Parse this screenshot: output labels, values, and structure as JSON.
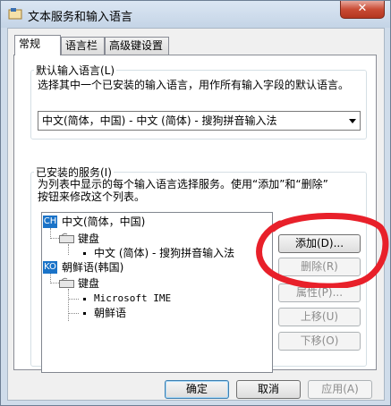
{
  "window": {
    "title": "文本服务和输入语言",
    "close_label": "✕"
  },
  "tabs": [
    {
      "label": "常规",
      "active": true
    },
    {
      "label": "语言栏",
      "active": false
    },
    {
      "label": "高级键设置",
      "active": false
    }
  ],
  "default_language": {
    "group_label": "默认输入语言(L)",
    "description": "选择其中一个已安装的输入语言，用作所有输入字段的默认语言。",
    "selected": "中文(简体，中国) - 中文 (简体) - 搜狗拼音输入法"
  },
  "installed_services": {
    "group_label": "已安装的服务(I)",
    "description_line1": "为列表中显示的每个输入语言选择服务。使用“添加”和“删除”",
    "description_line2": "按钮来修改这个列表。",
    "tree": {
      "lang1": {
        "badge": "CH",
        "name": "中文(简体，中国)",
        "category": "键盘",
        "service": "中文 (简体) - 搜狗拼音输入法"
      },
      "lang2": {
        "badge": "KO",
        "name": "朝鲜语(韩国)",
        "category": "键盘",
        "service1": "Microsoft IME",
        "service2": "朝鲜语"
      }
    },
    "buttons": {
      "add": "添加(D)...",
      "remove": "删除(R)",
      "properties": "属性(P)...",
      "move_up": "上移(U)",
      "move_down": "下移(O)"
    }
  },
  "footer": {
    "ok": "确定",
    "cancel": "取消",
    "apply": "应用(A)"
  },
  "colors": {
    "annotation": "#e8202a",
    "badge": "#1a73c8"
  }
}
